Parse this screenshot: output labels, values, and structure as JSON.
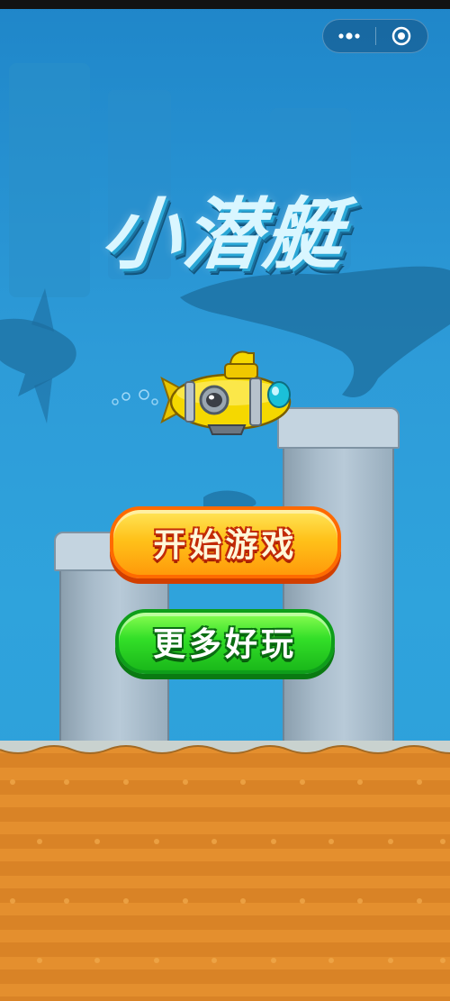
{
  "game": {
    "title": "小潜艇",
    "start_button": "开始游戏",
    "more_games_button": "更多好玩"
  },
  "capsule": {
    "more_icon": "more-dots-icon",
    "close_icon": "target-close-icon"
  },
  "colors": {
    "sky_top": "#1f86c9",
    "sky_bottom": "#2c9ed9",
    "ground": "#e48f2e",
    "start_button": "#ffc21a",
    "more_button": "#33df28",
    "submarine": "#f5d800"
  }
}
